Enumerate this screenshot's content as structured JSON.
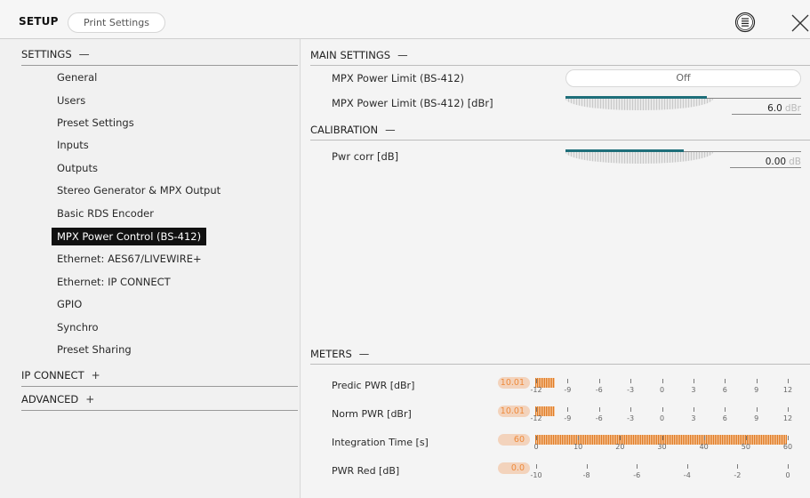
{
  "header": {
    "title": "SETUP",
    "tab": "Print Settings"
  },
  "sidebar": {
    "settings": {
      "label": "SETTINGS",
      "toggle": "—"
    },
    "items": [
      {
        "label": "General"
      },
      {
        "label": "Users"
      },
      {
        "label": "Preset Settings"
      },
      {
        "label": "Inputs"
      },
      {
        "label": "Outputs"
      },
      {
        "label": "Stereo Generator & MPX Output"
      },
      {
        "label": "Basic RDS Encoder"
      },
      {
        "label": "MPX Power Control (BS-412)",
        "active": true
      },
      {
        "label": "Ethernet: AES67/LIVEWIRE+"
      },
      {
        "label": "Ethernet: IP CONNECT"
      },
      {
        "label": "GPIO"
      },
      {
        "label": "Synchro"
      },
      {
        "label": "Preset Sharing"
      }
    ],
    "ip_connect": {
      "label": "IP CONNECT",
      "toggle": "+"
    },
    "advanced": {
      "label": "ADVANCED",
      "toggle": "+"
    }
  },
  "main": {
    "main_settings": {
      "label": "MAIN SETTINGS",
      "toggle": "—"
    },
    "mpx_limit": {
      "label": "MPX Power Limit (BS-412)",
      "value": "Off"
    },
    "mpx_limit_dbr": {
      "label": "MPX Power Limit (BS-412) [dBr]",
      "value": "6.0",
      "unit": "dBr",
      "level": 0.6
    },
    "calibration": {
      "label": "CALIBRATION",
      "toggle": "—"
    },
    "pwr_corr": {
      "label": "Pwr corr [dB]",
      "value": "0.00",
      "unit": "dB",
      "level": 0.5
    },
    "meters": {
      "label": "METERS",
      "toggle": "—",
      "rows": [
        {
          "label": "Predic PWR [dBr]",
          "value": "10.01",
          "ticks": [
            "-12",
            "-9",
            "-6",
            "-3",
            "0",
            "3",
            "6",
            "9",
            "12"
          ],
          "level": 0.05
        },
        {
          "label": "Norm PWR [dBr]",
          "value": "10.01",
          "ticks": [
            "-12",
            "-9",
            "-6",
            "-3",
            "0",
            "3",
            "6",
            "9",
            "12"
          ],
          "level": 0.05
        },
        {
          "label": "Integration Time [s]",
          "value": "60",
          "ticks": [
            "0",
            "10",
            "20",
            "30",
            "40",
            "50",
            "60"
          ],
          "level": 1.0
        },
        {
          "label": "PWR Red [dB]",
          "value": "0.0",
          "ticks": [
            "-10",
            "-8",
            "-6",
            "-4",
            "-2",
            "0"
          ],
          "level": 0.0
        }
      ]
    }
  },
  "colors": {
    "accent_fill": "#1f6f7a",
    "meter_orange": "#e07a22",
    "active_bg": "#111111"
  },
  "icons": [
    "list-circle-icon",
    "close-icon"
  ]
}
